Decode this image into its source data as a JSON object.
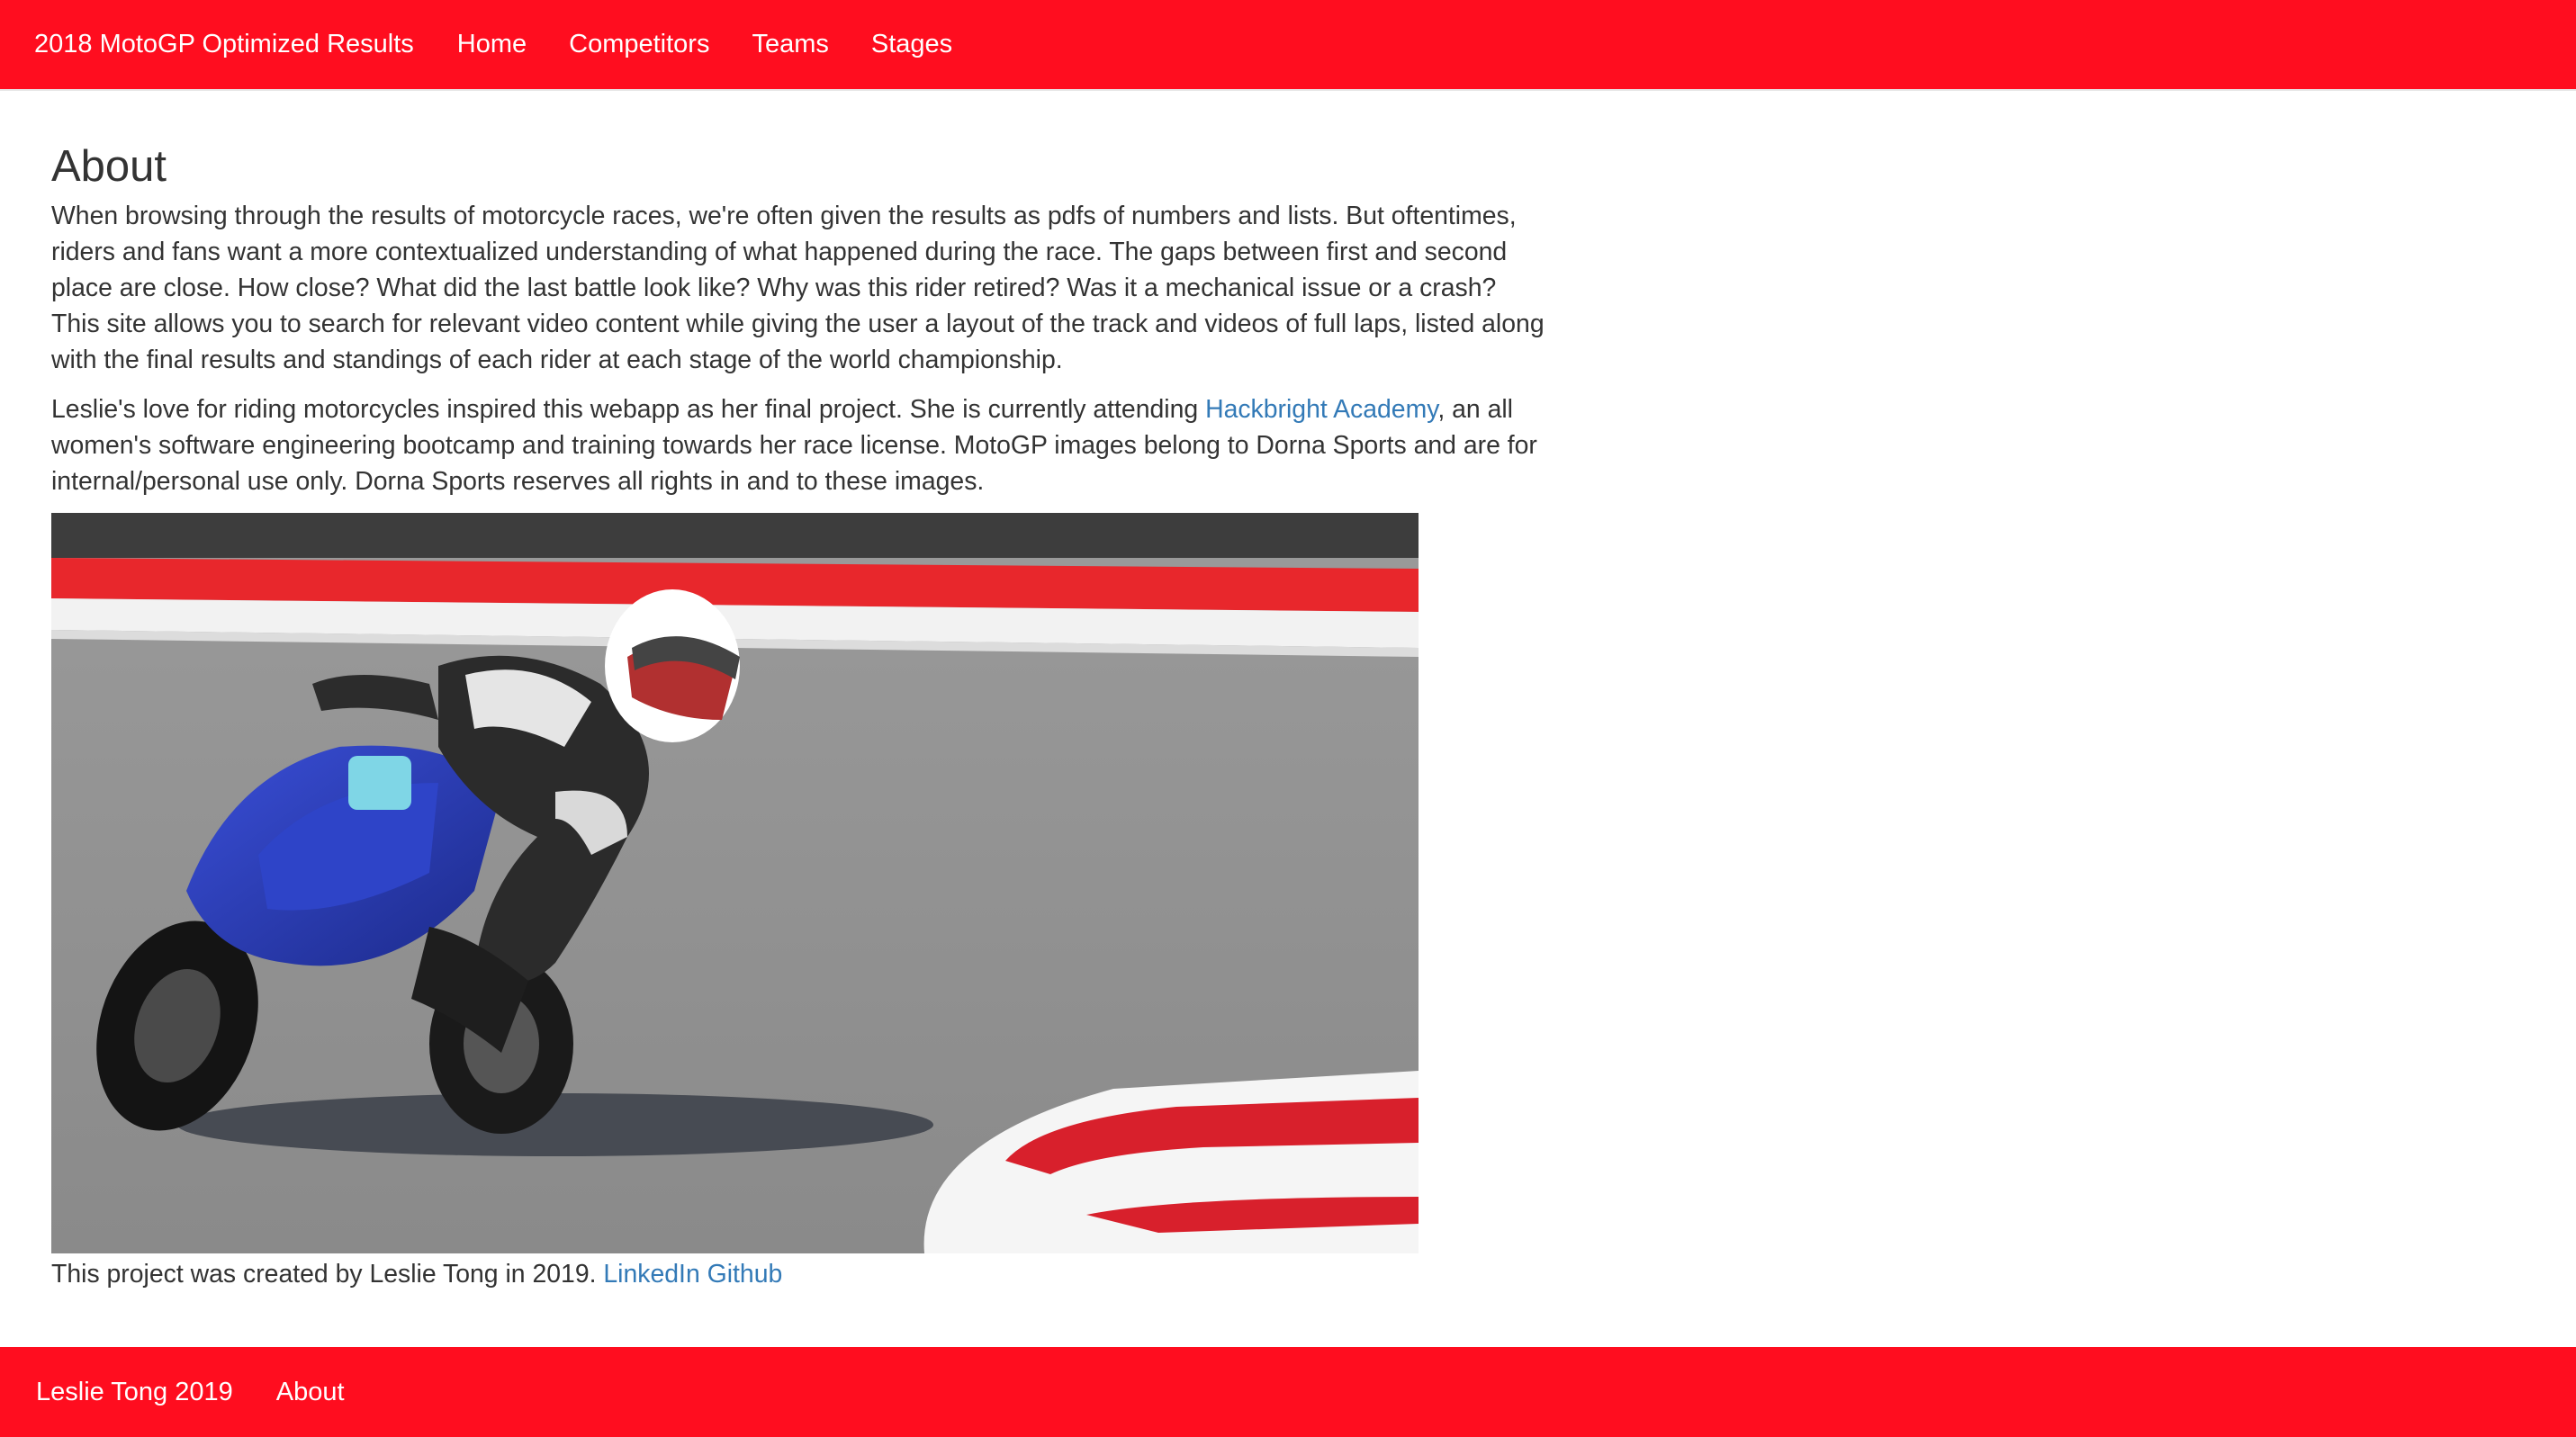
{
  "navbar": {
    "brand": "2018 MotoGP Optimized Results",
    "links": [
      "Home",
      "Competitors",
      "Teams",
      "Stages"
    ]
  },
  "main": {
    "title": "About",
    "paragraph1": "When browsing through the results of motorcycle races, we're often given the results as pdfs of numbers and lists. But oftentimes, riders and fans want a more contextualized understanding of what happened during the race. The gaps between first and second place are close. How close? What did the last battle look like? Why was this rider retired? Was it a mechanical issue or a crash? This site allows you to search for relevant video content while giving the user a layout of the track and videos of full laps, listed along with the final results and standings of each rider at each stage of the world championship.",
    "paragraph2": {
      "before_link": "Leslie's love for riding motorcycles inspired this webapp as her final project. She is currently attending ",
      "link": "Hackbright Academy",
      "after_link": ", an all women's software engineering bootcamp and training towards her race license. MotoGP images belong to Dorna Sports and are for internal/personal use only. Dorna Sports reserves all rights in and to these images."
    },
    "credit": {
      "text": "This project was created by Leslie Tong in 2019.",
      "linkedin": "LinkedIn",
      "github": "Github"
    }
  },
  "footer": {
    "copyright": "Leslie Tong 2019",
    "about": "About"
  },
  "colors": {
    "nav_bg": "#ff0d1f",
    "link": "#337ab7",
    "text": "#333333"
  }
}
